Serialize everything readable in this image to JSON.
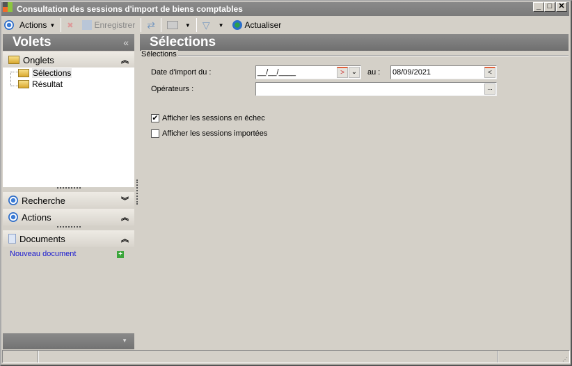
{
  "window": {
    "title": "Consultation des sessions d'import de biens comptables",
    "minimize": "_",
    "maximize": "□",
    "close": "✕"
  },
  "toolbar": {
    "actions": "Actions",
    "save": "Enregistrer",
    "refresh": "Actualiser"
  },
  "volets": {
    "title": "Volets",
    "collapse": "«",
    "onglets": {
      "label": "Onglets",
      "items": [
        "Sélections",
        "Résultat"
      ]
    },
    "recherche": "Recherche",
    "actions": "Actions",
    "documents": "Documents",
    "new_document": "Nouveau document"
  },
  "main": {
    "title": "Sélections",
    "group": "Sélections",
    "date_label": "Date d'import du :",
    "date_from": "__/__/____",
    "au_label": "au :",
    "date_to": "08/09/2021",
    "operators_label": "Opérateurs :",
    "operators_value": "",
    "ellipsis": "...",
    "chk_failed": {
      "label": "Afficher les sessions en échec",
      "checked": true
    },
    "chk_imported": {
      "label": "Afficher les sessions importées",
      "checked": false
    }
  }
}
